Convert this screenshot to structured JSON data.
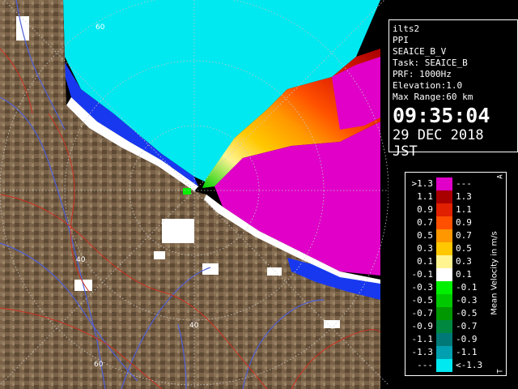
{
  "info": {
    "station": "ilts2",
    "product": "PPI",
    "scan": "SEAICE_B_V",
    "task": "Task: SEAICE_B",
    "prf": "PRF: 1000Hz",
    "elevation": "Elevation:1.0",
    "max_range": "Max Range:60 km",
    "time": "09:35:04",
    "date": "29 DEC 2018 JST"
  },
  "legend": {
    "title": "Mean Velocity in m/s",
    "corner_top": "A",
    "corner_bottom": "T",
    "rows": [
      {
        "low": ">1.3",
        "high": "---",
        "color": "#e000c8"
      },
      {
        "low": "1.1",
        "high": "1.3",
        "color": "#a80000"
      },
      {
        "low": "0.9",
        "high": "1.1",
        "color": "#e02000"
      },
      {
        "low": "0.7",
        "high": "0.9",
        "color": "#ff5000"
      },
      {
        "low": "0.5",
        "high": "0.7",
        "color": "#ff9800"
      },
      {
        "low": "0.3",
        "high": "0.5",
        "color": "#ffc800"
      },
      {
        "low": "0.1",
        "high": "0.3",
        "color": "#fff490"
      },
      {
        "low": "-0.1",
        "high": "0.1",
        "color": "#ffffff"
      },
      {
        "low": "-0.3",
        "high": "-0.1",
        "color": "#00f000"
      },
      {
        "low": "-0.5",
        "high": "-0.3",
        "color": "#00c800"
      },
      {
        "low": "-0.7",
        "high": "-0.5",
        "color": "#009800"
      },
      {
        "low": "-0.9",
        "high": "-0.7",
        "color": "#008840"
      },
      {
        "low": "-1.1",
        "high": "-0.9",
        "color": "#007878"
      },
      {
        "low": "-1.3",
        "high": "-1.1",
        "color": "#00a0b0"
      },
      {
        "low": "---",
        "high": "<-1.3",
        "color": "#00e8f0"
      }
    ]
  },
  "range_rings": {
    "labels": [
      "40",
      "60"
    ]
  },
  "colors": {
    "terrain": "#7a6248",
    "terrain_dark": "#5a4530",
    "sea_far": "#00e8f0",
    "approach_green": "#00b000",
    "recede_magenta": "#e000c8",
    "ice_blue": "#1838f0",
    "rivers": "#5060d8",
    "roads": "#d03020",
    "rings": "#c8c8c8"
  }
}
